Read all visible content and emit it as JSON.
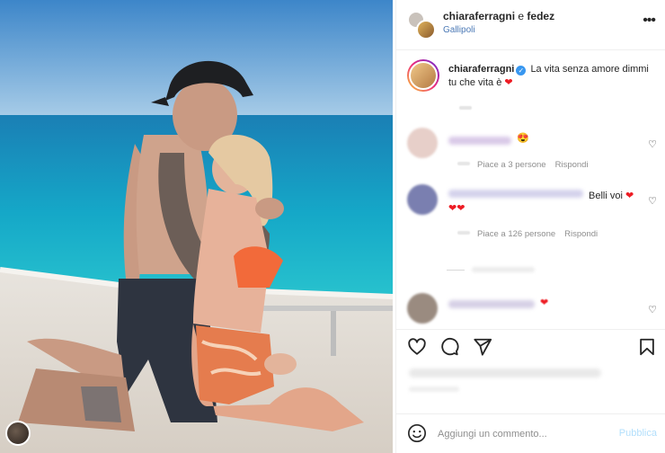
{
  "post": {
    "author_header": "chiaraferragni",
    "header_separator": "e",
    "coauthor": "fedez",
    "location": "Gallipoli",
    "more_icon": "more-horizontal-icon"
  },
  "caption": {
    "username": "chiaraferragni",
    "verified_icon": "verified-badge-icon",
    "text": "La vita senza amore dimmi tu che vita è",
    "emoji": "❤"
  },
  "comments": [
    {
      "text": "",
      "emoji": "😍",
      "likes": "Piace a 3 persone",
      "reply": "Rispondi",
      "avatar_color": "#e7cfc9"
    },
    {
      "text": "Belli voi",
      "emoji": "❤",
      "emoji_extra": "❤❤",
      "likes": "Piace a 126 persone",
      "reply": "Rispondi",
      "avatar_color": "#7a7fb0"
    },
    {
      "text": "",
      "emoji": "❤",
      "avatar_color": "#9a8b80"
    }
  ],
  "actions": {
    "like_icon": "heart-icon",
    "comment_icon": "comment-bubble-icon",
    "share_icon": "paper-plane-icon",
    "save_icon": "bookmark-icon"
  },
  "add_comment": {
    "placeholder": "Aggiungi un commento...",
    "publish_label": "Pubblica",
    "emoji_icon": "smiley-icon"
  },
  "colors": {
    "verified": "#3897f0",
    "heart": "#ed1c24",
    "publish_disabled": "#b2dffc",
    "location_link": "#4a78b5"
  }
}
